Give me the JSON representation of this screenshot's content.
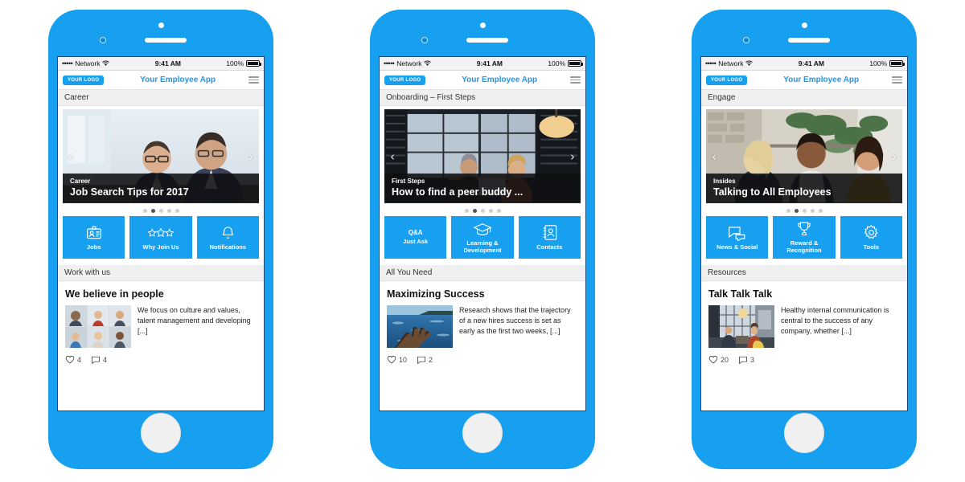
{
  "meta": {
    "accent_color": "#18a0f0",
    "frame_color": "#18a0f0",
    "dark_overlay": "#0e0e10"
  },
  "status_bar": {
    "signal_dots": "•••••",
    "carrier": "Network",
    "wifi_icon": "wifi-icon",
    "time": "9:41 AM",
    "battery_percent": "100%",
    "battery_icon": "battery-full-icon"
  },
  "app_header": {
    "logo_text": "YOUR LOGO",
    "title": "Your Employee App",
    "menu_icon": "hamburger-menu-icon"
  },
  "phones": [
    {
      "section_label": "Career",
      "carousel": {
        "prev_icon": "chevron-left-icon",
        "next_icon": "chevron-right-icon",
        "kicker": "Career",
        "headline": "Job Search Tips for 2017",
        "dot_count": 5,
        "active_dot": 1
      },
      "tiles": [
        {
          "icon": "id-badge-icon",
          "label": "Jobs",
          "top_label": ""
        },
        {
          "icon": "three-stars-icon",
          "label": "Why Join Us",
          "top_label": ""
        },
        {
          "icon": "bell-icon",
          "label": "Notifications",
          "top_label": ""
        }
      ],
      "feed_section_label": "Work with us",
      "article": {
        "title": "We believe in people",
        "excerpt": "We focus on culture and values, talent management and developing [...]",
        "likes": "4",
        "comments": "4",
        "like_icon": "heart-icon",
        "comment_icon": "comment-bubble-icon"
      }
    },
    {
      "section_label": "Onboarding – First Steps",
      "carousel": {
        "prev_icon": "chevron-left-icon",
        "next_icon": "chevron-right-icon",
        "kicker": "First Steps",
        "headline": "How to find a peer buddy ...",
        "dot_count": 5,
        "active_dot": 1
      },
      "tiles": [
        {
          "icon": "",
          "label": "Just Ask",
          "top_label": "Q&A"
        },
        {
          "icon": "graduation-cap-icon",
          "label": "Learning & Development",
          "top_label": ""
        },
        {
          "icon": "address-book-icon",
          "label": "Contacts",
          "top_label": ""
        }
      ],
      "feed_section_label": "All You Need",
      "article": {
        "title": "Maximizing Success",
        "excerpt": "Research shows that the trajectory of a new hires success is set as early as the first two weeks, [...]",
        "likes": "10",
        "comments": "2",
        "like_icon": "heart-icon",
        "comment_icon": "comment-bubble-icon"
      }
    },
    {
      "section_label": "Engage",
      "carousel": {
        "prev_icon": "chevron-left-icon",
        "next_icon": "chevron-right-icon",
        "kicker": "Insides",
        "headline": "Talking to All Employees",
        "dot_count": 5,
        "active_dot": 1
      },
      "tiles": [
        {
          "icon": "speech-bubbles-icon",
          "label": "News & Social",
          "top_label": ""
        },
        {
          "icon": "trophy-icon",
          "label": "Reward & Recognition",
          "top_label": ""
        },
        {
          "icon": "gear-icon",
          "label": "Tools",
          "top_label": ""
        }
      ],
      "feed_section_label": "Resources",
      "article": {
        "title": "Talk Talk Talk",
        "excerpt": "Healthy internal communication is central to the success of any company, whether [...]",
        "likes": "20",
        "comments": "3",
        "like_icon": "heart-icon",
        "comment_icon": "comment-bubble-icon"
      }
    }
  ]
}
